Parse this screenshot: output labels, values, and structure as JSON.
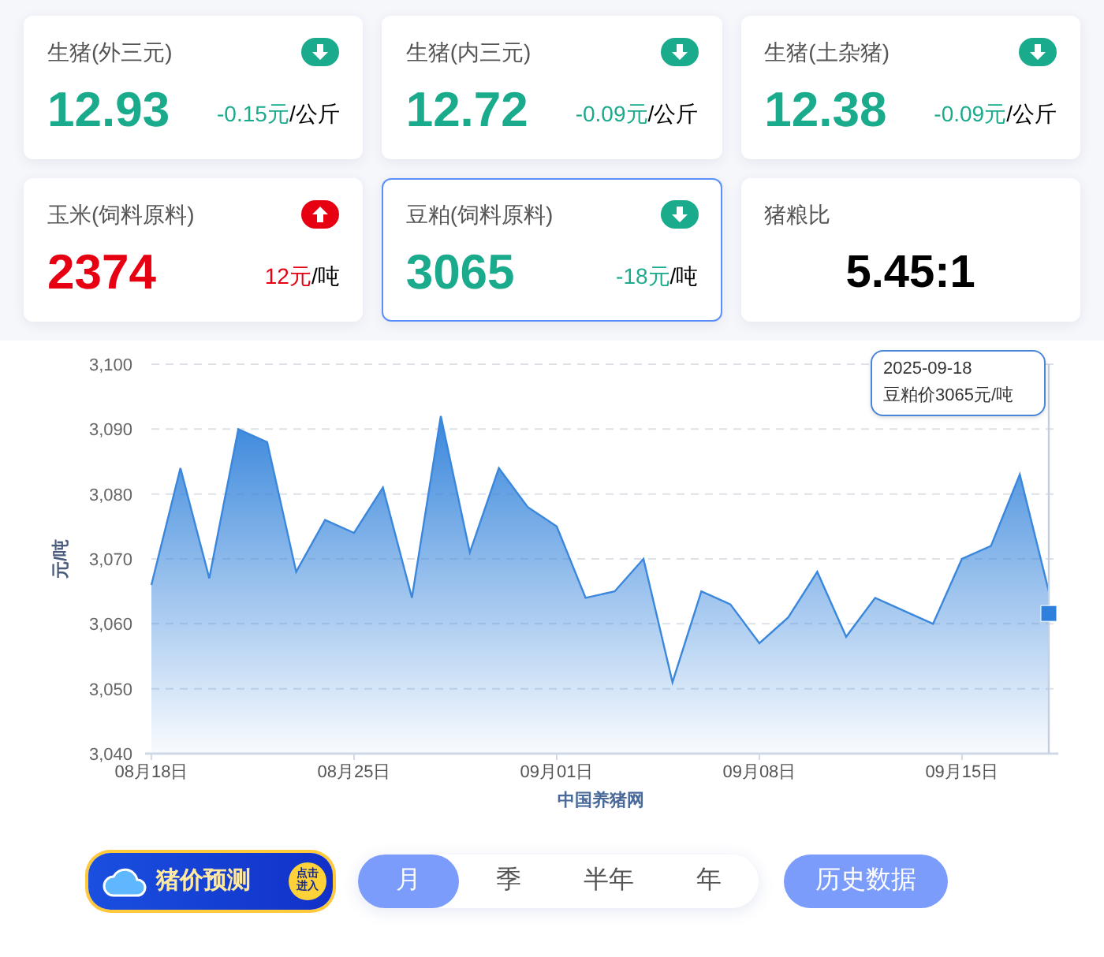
{
  "cards": [
    {
      "kind": "price",
      "title": "生猪(外三元)",
      "rising": false,
      "value": "12.93",
      "change": "-0.15元",
      "unit": "/公斤",
      "selected": false
    },
    {
      "kind": "price",
      "title": "生猪(内三元)",
      "rising": false,
      "value": "12.72",
      "change": "-0.09元",
      "unit": "/公斤",
      "selected": false
    },
    {
      "kind": "price",
      "title": "生猪(土杂猪)",
      "rising": false,
      "value": "12.38",
      "change": "-0.09元",
      "unit": "/公斤",
      "selected": false
    },
    {
      "kind": "price",
      "title": "玉米(饲料原料)",
      "rising": true,
      "value": "2374",
      "change": "12元",
      "unit": "/吨",
      "selected": false
    },
    {
      "kind": "price",
      "title": "豆粕(饲料原料)",
      "rising": false,
      "value": "3065",
      "change": "-18元",
      "unit": "/吨",
      "selected": true
    },
    {
      "kind": "ratio",
      "title": "猪粮比",
      "value": "5.45:1",
      "selected": false
    }
  ],
  "chart": {
    "chart_data": {
      "type": "area",
      "xlabel": "中国养猪网",
      "ylabel": "元/吨",
      "categories": [
        "08月18日",
        null,
        null,
        null,
        null,
        null,
        null,
        "08月25日",
        null,
        null,
        null,
        null,
        null,
        null,
        "09月01日",
        null,
        null,
        null,
        null,
        null,
        null,
        "09月08日",
        null,
        null,
        null,
        null,
        null,
        null,
        "09月15日",
        null,
        null,
        null
      ],
      "grid": true,
      "series": [
        {
          "color": "#3a87dc",
          "values": [
            3066,
            3084,
            3067,
            3090,
            3088,
            3068,
            3076,
            3074,
            3081,
            3064,
            3092,
            3071,
            3084,
            3078,
            3075,
            3064,
            3065,
            3070,
            3051,
            3065,
            3063,
            3057,
            3061,
            3068,
            3058,
            3064,
            3062,
            3060,
            3070,
            3072,
            3083,
            3065
          ]
        }
      ],
      "ylim": [
        3040,
        3100
      ],
      "yticks": [
        {
          "value": 3040,
          "label": "3,040"
        },
        {
          "value": 3050,
          "label": "3,050"
        },
        {
          "value": 3060,
          "label": "3,060"
        },
        {
          "value": 3070,
          "label": "3,070"
        },
        {
          "value": 3080,
          "label": "3,080"
        },
        {
          "value": 3090,
          "label": "3,090"
        },
        {
          "value": 3100,
          "label": "3,100"
        }
      ]
    },
    "tooltip": {
      "date": "2025-09-18",
      "text": "豆粕价3065元/吨"
    }
  },
  "forecast_banner": {
    "title": "猪价预测",
    "badge": "点击进入"
  },
  "period_tabs": [
    {
      "label": "月",
      "selected": true
    },
    {
      "label": "季",
      "selected": false
    },
    {
      "label": "半年",
      "selected": false
    },
    {
      "label": "年",
      "selected": false
    }
  ],
  "history_button": "历史数据"
}
